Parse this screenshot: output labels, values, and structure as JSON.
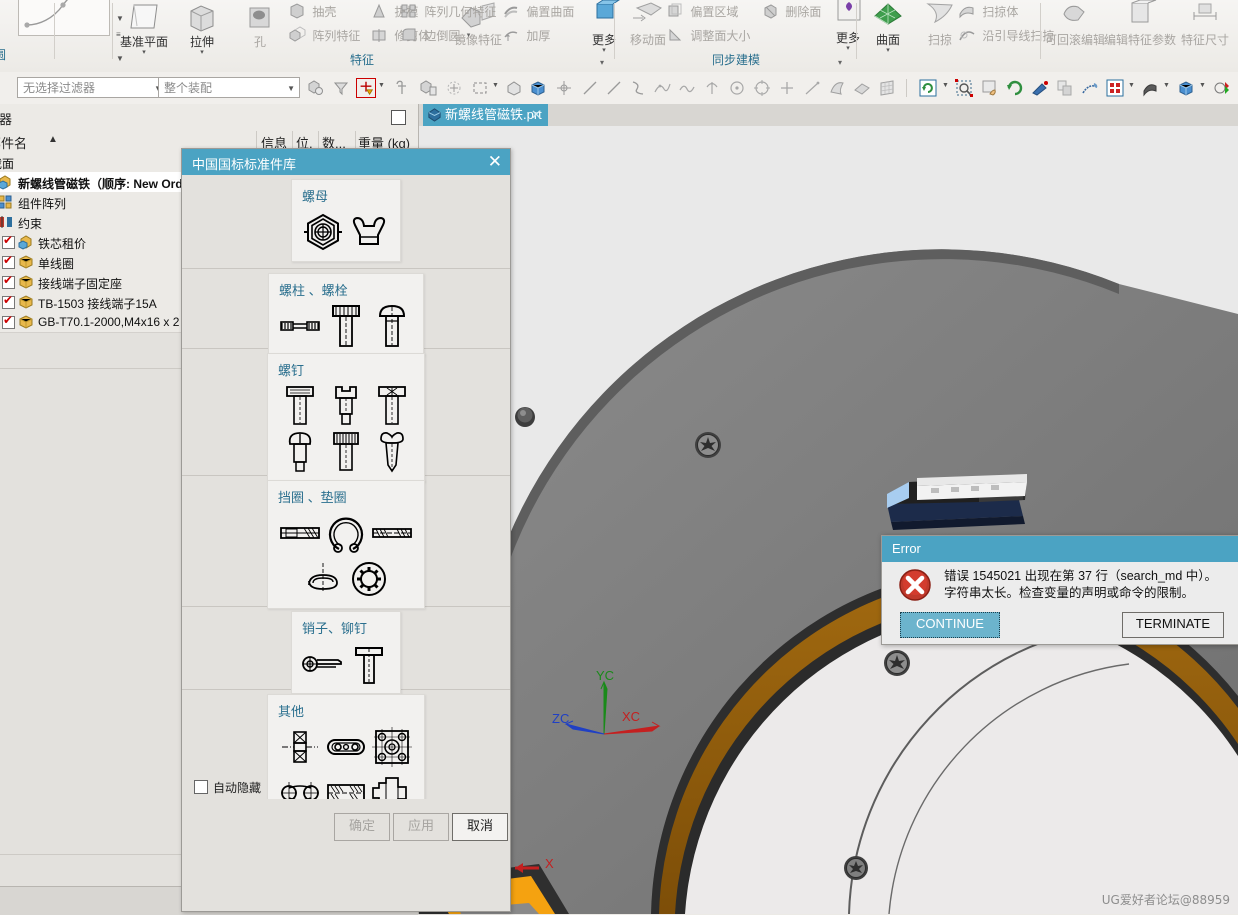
{
  "ribbon": {
    "groups": [
      {
        "label": "特征",
        "exp": "▾"
      },
      {
        "label": "同步建模",
        "exp": "▾"
      }
    ],
    "feature_big": [
      {
        "label": "基准平面",
        "arrow": "▾",
        "icon": "datum-plane-icon",
        "dim": false
      },
      {
        "label": "拉伸",
        "arrow": "▾",
        "icon": "extrude-icon",
        "dim": false
      },
      {
        "label": "孔",
        "arrow": "",
        "icon": "hole-icon",
        "dim": true
      },
      {
        "label": "镜像特征",
        "arrow": "",
        "icon": "mirror-feature-icon",
        "dim": true
      },
      {
        "label": "更多",
        "arrow": "▾",
        "icon": "more-icon",
        "dim": false
      }
    ],
    "feature_small": [
      {
        "label": "抽壳",
        "icon": "shell-icon"
      },
      {
        "label": "阵列特征",
        "icon": "pattern-feature-icon"
      },
      {
        "label": "拔模",
        "icon": "draft-icon"
      },
      {
        "label": "修剪体",
        "icon": "trim-body-icon"
      },
      {
        "label": "阵列几何特征",
        "icon": "pattern-geometry-icon"
      },
      {
        "label": "边倒圆",
        "icon": "edge-blend-icon",
        "dd": "▾"
      },
      {
        "label": "偏置曲面",
        "icon": "offset-surface-icon"
      },
      {
        "label": "加厚",
        "icon": "thicken-icon"
      }
    ],
    "sync_big": [
      {
        "label": "移动面",
        "arrow": "",
        "icon": "move-face-icon",
        "dim": true
      },
      {
        "label": "更多",
        "arrow": "▾",
        "icon": "more-icon",
        "dim": false
      }
    ],
    "sync_small": [
      {
        "label": "偏置区域",
        "icon": "offset-region-icon"
      },
      {
        "label": "调整面大小",
        "icon": "resize-face-icon"
      },
      {
        "label": "删除面",
        "icon": "delete-face-icon"
      }
    ],
    "surface_big": [
      {
        "label": "曲面",
        "arrow": "▾",
        "icon": "surface-icon",
        "dim": false
      },
      {
        "label": "扫掠",
        "arrow": "",
        "icon": "sweep-icon",
        "dim": true
      }
    ],
    "surface_small": [
      {
        "label": "扫掠体",
        "icon": "swept-body-icon"
      },
      {
        "label": "沿引导线扫掠",
        "icon": "sweep-along-guide-icon"
      }
    ],
    "edit_big": [
      {
        "label": "可回滚编辑",
        "icon": "rollback-edit-icon"
      },
      {
        "label": "编辑特征参数",
        "icon": "edit-feature-params-icon"
      },
      {
        "label": "特征尺寸",
        "icon": "feature-dimension-icon"
      }
    ]
  },
  "selbar": {
    "filter": {
      "value": "无选择过滤器",
      "placeholder": "无选择过滤器"
    },
    "scope": {
      "value": "整个装配",
      "placeholder": "整个装配"
    },
    "icons": [
      "select-general-icon",
      "filter-select-icon",
      "point-snap-icon",
      "datum-select-icon",
      "feature-select-icon",
      "face-select-icon",
      "rect-select-icon",
      "body-select-icon",
      "solid-body-icon",
      "move-object-icon",
      "line-icon",
      "line2-icon",
      "arc-icon",
      "spline-icon",
      "studio-spline-icon",
      "helix-icon",
      "circle-icon",
      "ellipse-icon",
      "point-icon",
      "line3-icon",
      "sheet-icon",
      "surface2-icon",
      "grid-icon",
      "refresh-icon",
      "zoom-window-icon",
      "pan-icon",
      "rotate-icon",
      "fit-icon",
      "render-style-icon",
      "true-shading-icon",
      "layout-icon",
      "shade-icon",
      "cube-icon",
      "color-icon"
    ]
  },
  "leftpanel": {
    "title": "抗器",
    "columns": [
      "部件名",
      "信息",
      "位.",
      "数...",
      "重量 (kg)"
    ],
    "sort_arrow": "▲",
    "rows": [
      {
        "text": "截面",
        "checked": false,
        "bold": false,
        "icon": "section-icon",
        "indent": 0,
        "noicon": true
      },
      {
        "text": "新螺线管磁铁（顺序: New Ord",
        "checked": false,
        "bold": true,
        "icon": "assembly-icon",
        "indent": 0
      },
      {
        "text": "组件阵列",
        "checked": false,
        "bold": false,
        "icon": "component-pattern-icon",
        "indent": 0
      },
      {
        "text": "约束",
        "checked": false,
        "bold": false,
        "icon": "constraint-icon",
        "indent": 0
      },
      {
        "text": "铁芯租价",
        "checked": true,
        "bold": false,
        "icon": "subassembly-icon",
        "indent": 1
      },
      {
        "text": "单线圈",
        "checked": true,
        "bold": false,
        "icon": "part-icon",
        "indent": 1
      },
      {
        "text": "接线端子固定座",
        "checked": true,
        "bold": false,
        "icon": "part-icon",
        "indent": 1
      },
      {
        "text": "TB-1503 接线端子15A",
        "checked": true,
        "bold": false,
        "icon": "part-icon",
        "indent": 1
      },
      {
        "text": "GB-T70.1-2000,M4x16 x 2",
        "checked": true,
        "bold": false,
        "icon": "part-icon",
        "indent": 1
      }
    ]
  },
  "tabs": [
    {
      "label": "新螺线管磁铁.prt",
      "close": "✕",
      "icon": "part-file-icon",
      "active": true
    }
  ],
  "viewport": {
    "triad": [
      {
        "label": "YC",
        "color": "#1a8a1a"
      },
      {
        "label": "XC",
        "color": "#c42020"
      },
      {
        "label": "ZC",
        "color": "#2040c4"
      }
    ],
    "origin_label": {
      "label": "X",
      "color": "#c42020"
    },
    "watermark": "UG爱好者论坛@88959",
    "colors": {
      "body_gray": "#7b7b7b",
      "dark_edge": "#3a3a3a",
      "copper": "#8f5b0a",
      "orange": "#f29400",
      "background": "#e9e9e9"
    }
  },
  "parts_dialog": {
    "title": "中国国标标准件库",
    "close": "✕",
    "sections": [
      {
        "title": "螺母",
        "icons": [
          "hex-nut-icon",
          "wing-nut-icon"
        ],
        "cols": 2
      },
      {
        "title": "螺柱 、螺栓",
        "icons": [
          "stud-icon",
          "hex-bolt-icon",
          "round-head-bolt-icon"
        ],
        "cols": 3
      },
      {
        "title": "螺钉",
        "icons": [
          "slotted-screw-icon",
          "socket-screw-icon",
          "cross-screw-icon",
          "hex-head-screw-icon",
          "knurled-screw-icon",
          "pan-head-screw-icon"
        ],
        "cols": 3
      },
      {
        "title": "挡圈 、垫圈",
        "icons": [
          "retaining-ring-icon",
          "snap-ring-icon",
          "flat-washer-icon",
          "spring-washer-icon",
          "tooth-lock-washer-icon"
        ],
        "cols": 3
      },
      {
        "title": "销子、铆钉",
        "icons": [
          "cotter-pin-icon",
          "rivet-icon"
        ],
        "cols": 2
      },
      {
        "title": "其他",
        "icons": [
          "key-icon",
          "plate-icon",
          "bearing-plate-icon",
          "chain-link-icon",
          "bushing-icon",
          "shaft-icon",
          "bearing-icon",
          "seal-icon",
          "gear-icon"
        ],
        "cols": 3
      }
    ],
    "autohide": {
      "label": "自动隐藏",
      "checked": false
    },
    "buttons": [
      {
        "label": "确定",
        "state": "disabled"
      },
      {
        "label": "应用",
        "state": "disabled"
      },
      {
        "label": "取消",
        "state": "active"
      }
    ]
  },
  "error_dialog": {
    "title": "Error",
    "icon": "error-icon",
    "message_line1": "错误 1545021 出现在第 37 行（search_md 中）。",
    "message_line2": "字符串太长。检查变量的声明或命令的限制。",
    "buttons": [
      {
        "label": "CONTINUE",
        "primary": true
      },
      {
        "label": "TERMINATE",
        "primary": false
      }
    ]
  }
}
